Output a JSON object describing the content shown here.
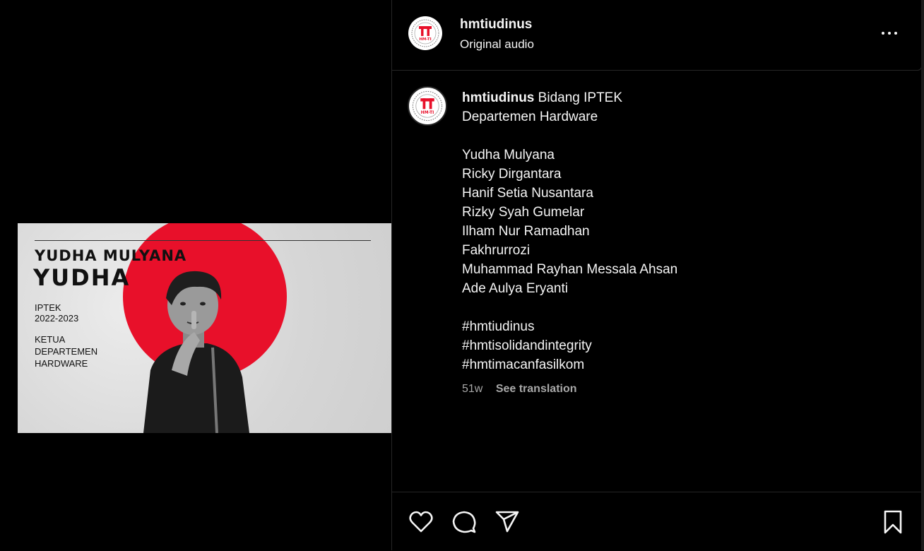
{
  "post": {
    "username": "hmtiudinus",
    "audio_label": "Original audio"
  },
  "thumbnail": {
    "name_small": "YUDHA MULYANA",
    "name_big": "YUDHA",
    "division": "IPTEK",
    "period": "2022-2023",
    "role_lines": [
      "KETUA",
      "DEPARTEMEN",
      "HARDWARE"
    ],
    "accent_color": "#e8102a"
  },
  "caption": {
    "username": "hmtiudinus",
    "first_line_text": "Bidang IPTEK",
    "lines": [
      "Departemen Hardware"
    ],
    "members": [
      "Yudha Mulyana",
      "Ricky Dirgantara",
      "Hanif Setia Nusantara",
      "Rizky Syah Gumelar",
      "Ilham Nur Ramadhan",
      "Fakhrurrozi",
      "Muhammad Rayhan Messala Ahsan",
      "Ade Aulya Eryanti"
    ],
    "hashtags": [
      "#hmtiudinus",
      "#hmtisolidandintegrity",
      "#hmtimacanfasilkom"
    ],
    "age": "51w",
    "see_translation": "See translation"
  },
  "logo": {
    "text": "HM-TI"
  },
  "icons": {
    "more": "more-options-icon",
    "like": "heart-icon",
    "comment": "comment-icon",
    "share": "share-icon",
    "save": "bookmark-icon"
  }
}
